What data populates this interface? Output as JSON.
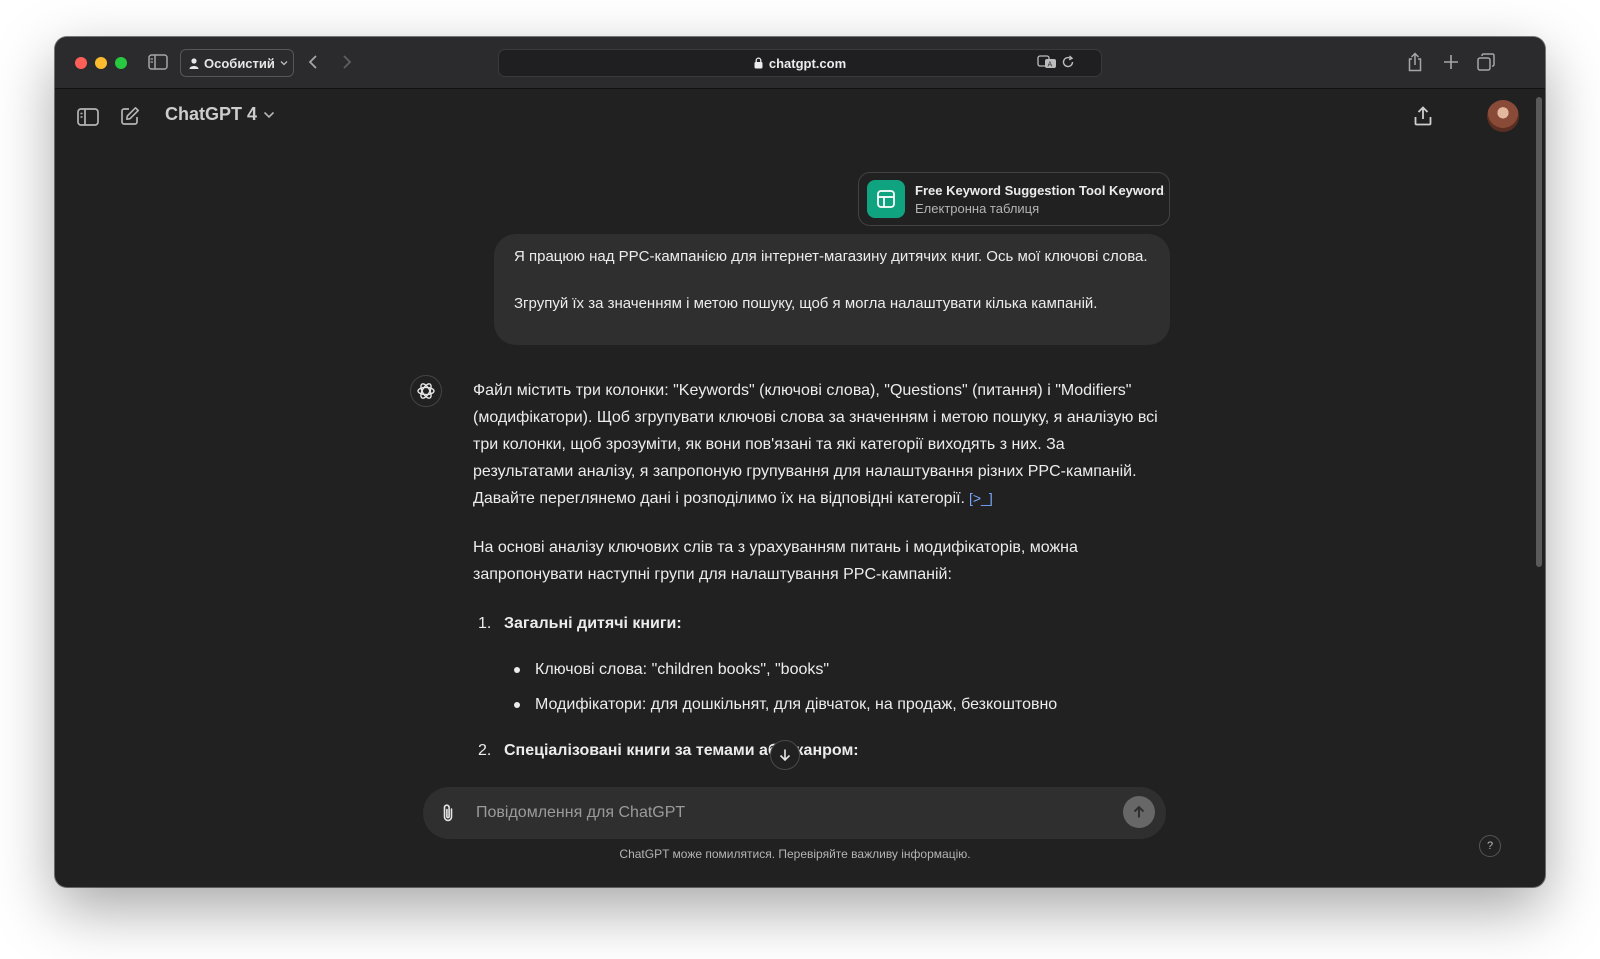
{
  "browser": {
    "profile_label": "Особистий",
    "url": "chatgpt.com"
  },
  "header": {
    "model_name": "ChatGPT 4"
  },
  "attachment": {
    "name": "Free Keyword Suggestion Tool Keyword...",
    "type": "Електронна таблиця"
  },
  "user_message": {
    "paragraph1": "Я працюю над PPC-кампанією для інтернет-магазину дитячих книг. Ось мої ключові слова.",
    "paragraph2": "Згрупуй їх за значенням і метою пошуку, щоб я могла налаштувати кілька кампаній."
  },
  "assistant_message": {
    "paragraph1": "Файл містить три колонки: \"Keywords\" (ключові слова), \"Questions\" (питання) і \"Modifiers\" (модифікатори). Щоб згрупувати ключові слова за значенням і метою пошуку, я аналізую всі три колонки, щоб зрозуміти, як вони пов'язані та які категорії виходять з них. За результатами аналізу, я запропоную групування для налаштування різних PPC-кампаній. Давайте переглянемо дані і розподілимо їх на відповідні категорії.",
    "citation": "[>_]",
    "paragraph2": "На основі аналізу ключових слів та з урахуванням питань і модифікаторів, можна запропонувати наступні групи для налаштування PPC-кампаній:",
    "groups": [
      {
        "number": "1.",
        "title": "Загальні дитячі книги:",
        "items": [
          "Ключові слова: \"children books\", \"books\"",
          "Модифікатори: для дошкільнят, для дівчаток, на продаж, безкоштовно"
        ]
      },
      {
        "number": "2.",
        "title": "Спеціалізовані книги за темами або жанром:"
      }
    ]
  },
  "composer": {
    "placeholder": "Повідомлення для ChatGPT"
  },
  "footer": {
    "disclaimer": "ChatGPT може помилятися. Перевіряйте важливу інформацію.",
    "help": "?"
  }
}
